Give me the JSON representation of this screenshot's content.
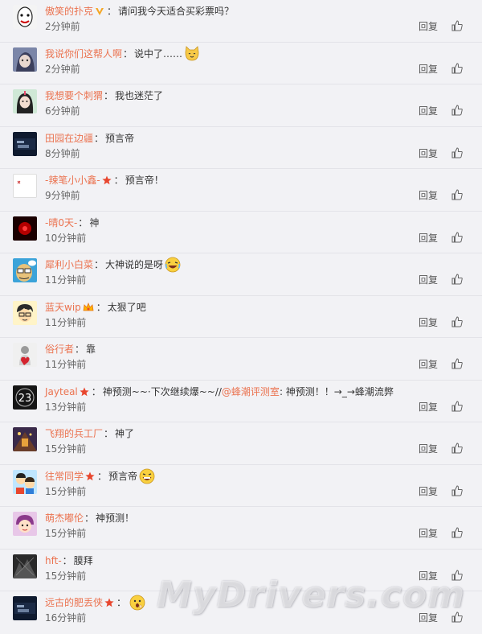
{
  "reply_label": "回复",
  "colors": {
    "username": "#eb7350",
    "badge_star": "#e8462e",
    "badge_v": "#f5a623"
  },
  "watermark": "MyDrivers.com",
  "comments": [
    {
      "name": "傲笑的扑克",
      "sep": "：",
      "text": "请问我今天适合买彩票吗？",
      "time": "2分钟前",
      "badge": "v-icon"
    },
    {
      "name": "我说你们这帮人啊",
      "sep": "：",
      "text": "说中了……",
      "time": "2分钟前",
      "emoji": "cat-emoji"
    },
    {
      "name": "我想要个刺猬",
      "sep": "：",
      "text": "我也迷茫了",
      "time": "6分钟前"
    },
    {
      "name": "田园在边疆",
      "sep": "：",
      "text": "预言帝",
      "time": "8分钟前"
    },
    {
      "name": "-辣笔小小鑫-",
      "sep": "：",
      "text": "预言帝！",
      "time": "9分钟前",
      "badge": "star-icon"
    },
    {
      "name": "-晴0天-",
      "sep": "：",
      "text": "神",
      "time": "10分钟前"
    },
    {
      "name": "犀利小白菜",
      "sep": "：",
      "text": "大神说的是呀",
      "time": "11分钟前",
      "emoji": "laugh-emoji"
    },
    {
      "name": "蓝天wip",
      "sep": "：",
      "text": "太狠了吧",
      "time": "11分钟前",
      "badge": "crown-icon"
    },
    {
      "name": "俗行者",
      "sep": "：",
      "text": "靠",
      "time": "11分钟前"
    },
    {
      "name": "Jayteal",
      "sep": "：",
      "text": "神预测~~·下次继续爆~~//",
      "mention": "@蜂潮评测室",
      "text2": ": 神预测！！→_→蜂潮流弊",
      "time": "13分钟前",
      "badge": "star-icon"
    },
    {
      "name": "飞翔的兵工厂",
      "sep": "：",
      "text": "神了",
      "time": "15分钟前"
    },
    {
      "name": "往常同学",
      "sep": "：",
      "text": "预言帝",
      "time": "15分钟前",
      "badge": "star-icon",
      "emoji": "grin-emoji"
    },
    {
      "name": "萌杰嘟伦",
      "sep": "：",
      "text": "神预测！",
      "time": "15分钟前"
    },
    {
      "name": "hft-",
      "sep": "：",
      "text": "膜拜",
      "time": "15分钟前"
    },
    {
      "name": "远古的肥丢侠",
      "sep": "：",
      "text": "",
      "time": "16分钟前",
      "badge": "star-icon",
      "emoji": "surprised-emoji"
    }
  ]
}
